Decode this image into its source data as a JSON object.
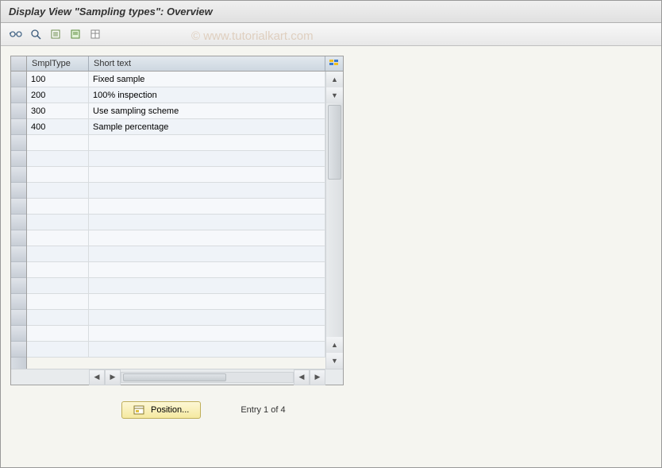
{
  "title": "Display View \"Sampling types\": Overview",
  "watermark": "© www.tutorialkart.com",
  "toolbar": {
    "icons": {
      "change": "glasses-icon",
      "search": "search-icon",
      "list1": "export-icon",
      "list2": "export-green-icon",
      "list3": "spreadsheet-icon"
    }
  },
  "table": {
    "columns": {
      "smplType": "SmplType",
      "shortText": "Short text"
    },
    "rows": [
      {
        "type": "100",
        "text": "Fixed sample"
      },
      {
        "type": "200",
        "text": "100% inspection"
      },
      {
        "type": "300",
        "text": "Use sampling scheme"
      },
      {
        "type": "400",
        "text": "Sample percentage"
      },
      {
        "type": "",
        "text": ""
      },
      {
        "type": "",
        "text": ""
      },
      {
        "type": "",
        "text": ""
      },
      {
        "type": "",
        "text": ""
      },
      {
        "type": "",
        "text": ""
      },
      {
        "type": "",
        "text": ""
      },
      {
        "type": "",
        "text": ""
      },
      {
        "type": "",
        "text": ""
      },
      {
        "type": "",
        "text": ""
      },
      {
        "type": "",
        "text": ""
      },
      {
        "type": "",
        "text": ""
      },
      {
        "type": "",
        "text": ""
      },
      {
        "type": "",
        "text": ""
      },
      {
        "type": "",
        "text": ""
      }
    ]
  },
  "footer": {
    "positionLabel": "Position...",
    "entryLabel": "Entry 1 of 4"
  }
}
